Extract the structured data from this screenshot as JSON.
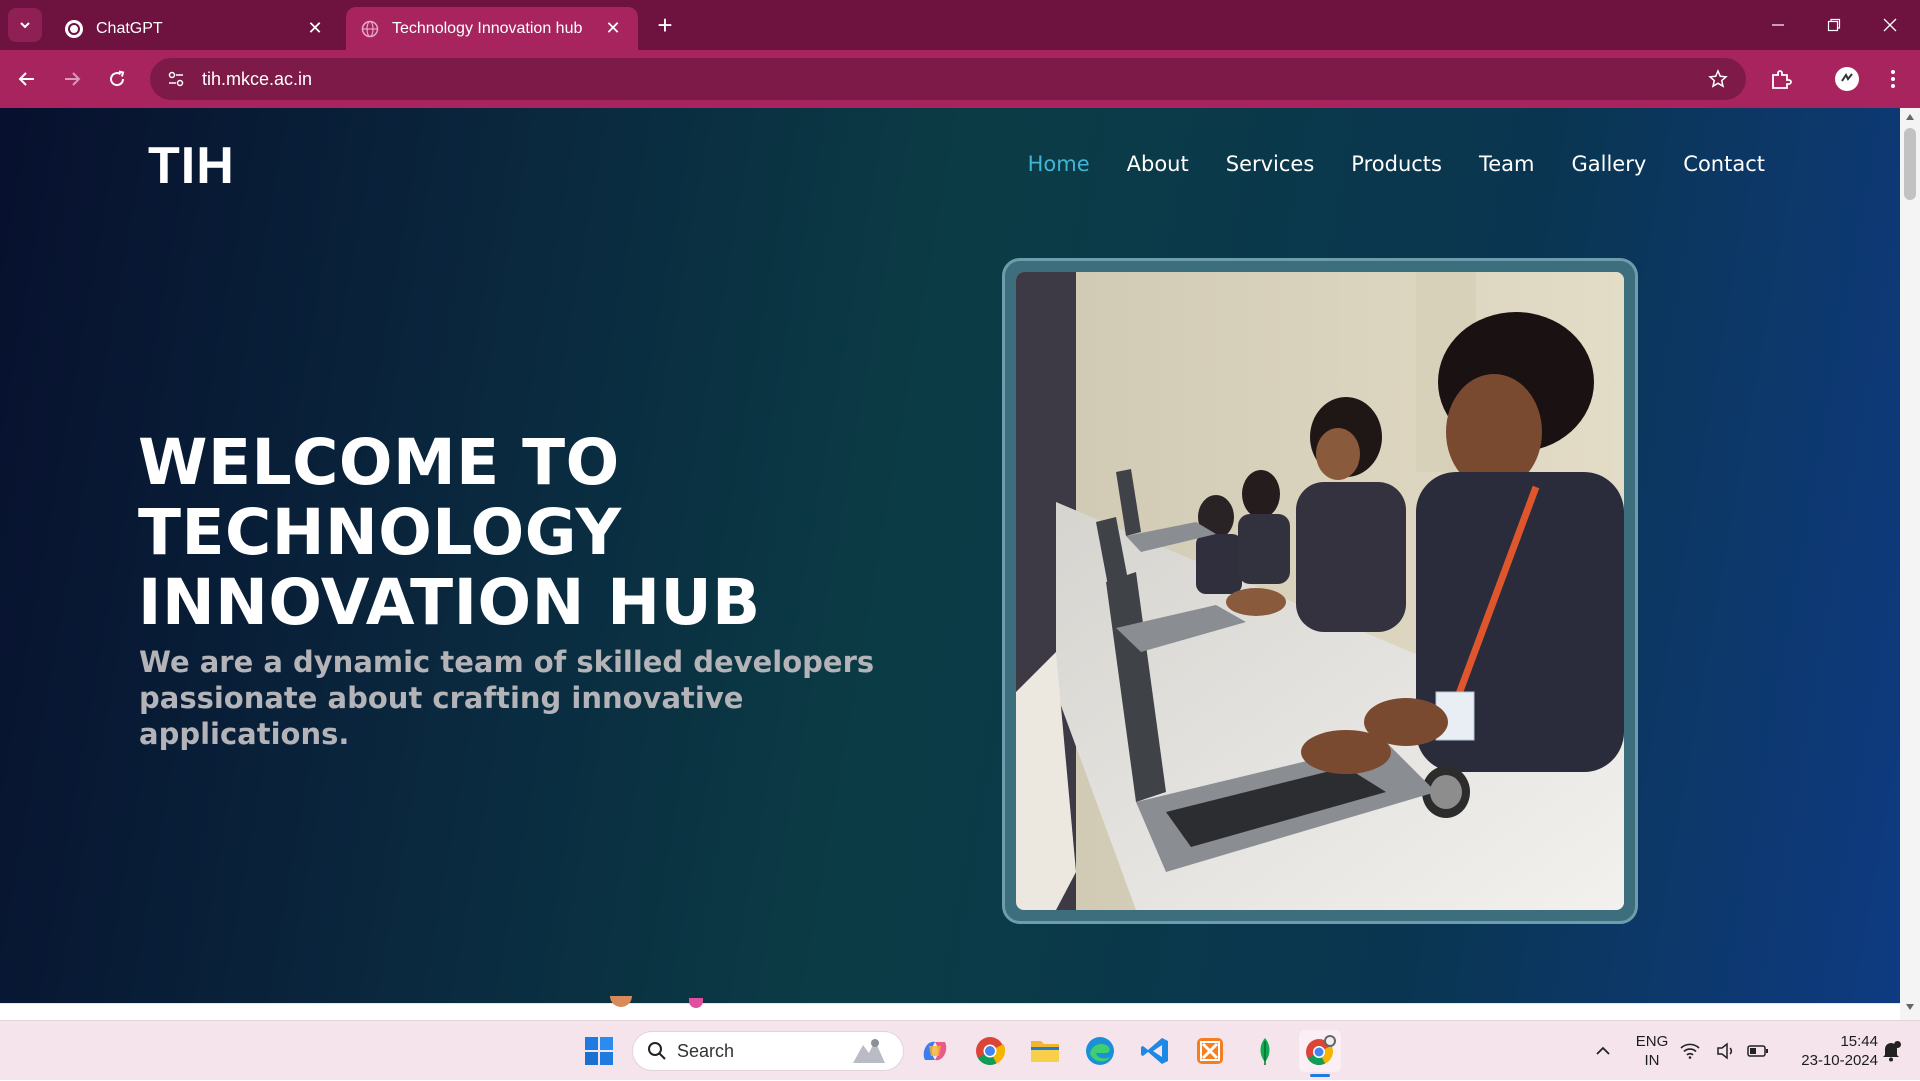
{
  "browser": {
    "tabs": [
      {
        "title": "ChatGPT",
        "active": false
      },
      {
        "title": "Technology Innovation hub",
        "active": true
      }
    ],
    "url": "tih.mkce.ac.in"
  },
  "site": {
    "logo": "TIH",
    "nav": [
      "Home",
      "About",
      "Services",
      "Products",
      "Team",
      "Gallery",
      "Contact"
    ],
    "hero": {
      "title_lines": [
        "WELCOME TO",
        "TECHNOLOGY",
        "INNOVATION HUB"
      ],
      "subtitle": "We are a dynamic team of skilled developers passionate about crafting innovative applications."
    }
  },
  "taskbar": {
    "search_label": "Search",
    "language": "ENG",
    "region": "IN",
    "time": "15:44",
    "date": "23-10-2024"
  },
  "colors": {
    "chrome_tabbar": "#6e1240",
    "chrome_toolbar": "#a8245e",
    "nav_active": "#41b5d6",
    "hero_text": "#ffffff",
    "subtitle_text": "#b3b3b8"
  }
}
